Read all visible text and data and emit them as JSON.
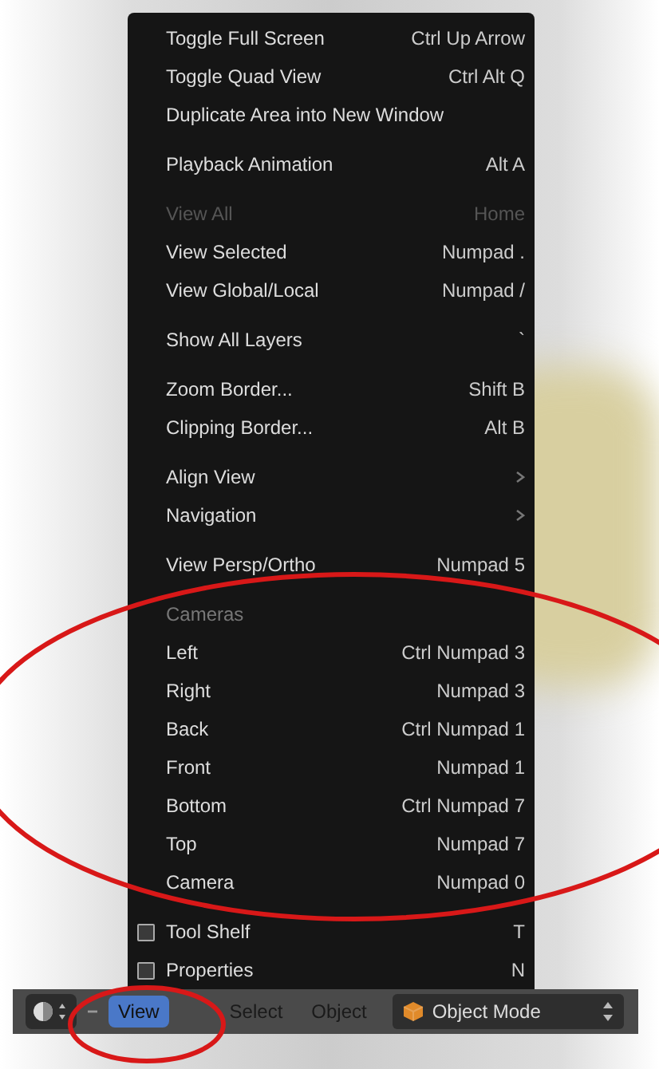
{
  "menu": {
    "sections": [
      {
        "items": [
          {
            "kind": "item",
            "label": "Toggle Full Screen",
            "shortcut": "Ctrl Up Arrow",
            "disabled": false
          },
          {
            "kind": "item",
            "label": "Toggle Quad View",
            "shortcut": "Ctrl Alt Q",
            "disabled": false
          },
          {
            "kind": "item",
            "label": "Duplicate Area into New Window",
            "disabled": false
          }
        ]
      },
      {
        "items": [
          {
            "kind": "item",
            "label": "Playback Animation",
            "shortcut": "Alt A",
            "disabled": false
          }
        ]
      },
      {
        "items": [
          {
            "kind": "item",
            "label": "View All",
            "shortcut": "Home",
            "disabled": true
          },
          {
            "kind": "item",
            "label": "View Selected",
            "shortcut": "Numpad .",
            "disabled": false
          },
          {
            "kind": "item",
            "label": "View Global/Local",
            "shortcut": "Numpad /",
            "disabled": false
          }
        ]
      },
      {
        "items": [
          {
            "kind": "item",
            "label": "Show All Layers",
            "shortcut": "`",
            "disabled": false
          }
        ]
      },
      {
        "items": [
          {
            "kind": "item",
            "label": "Zoom Border...",
            "shortcut": "Shift B",
            "disabled": false
          },
          {
            "kind": "item",
            "label": "Clipping Border...",
            "shortcut": "Alt B",
            "disabled": false
          }
        ]
      },
      {
        "items": [
          {
            "kind": "submenu",
            "label": "Align View",
            "disabled": false
          },
          {
            "kind": "submenu",
            "label": "Navigation",
            "disabled": false
          }
        ]
      },
      {
        "items": [
          {
            "kind": "item",
            "label": "View Persp/Ortho",
            "shortcut": "Numpad 5",
            "disabled": false
          }
        ]
      },
      {
        "items": [
          {
            "kind": "heading",
            "label": "Cameras"
          },
          {
            "kind": "item",
            "label": "Left",
            "shortcut": "Ctrl Numpad 3",
            "disabled": false
          },
          {
            "kind": "item",
            "label": "Right",
            "shortcut": "Numpad 3",
            "disabled": false
          },
          {
            "kind": "item",
            "label": "Back",
            "shortcut": "Ctrl Numpad 1",
            "disabled": false
          },
          {
            "kind": "item",
            "label": "Front",
            "shortcut": "Numpad 1",
            "disabled": false
          },
          {
            "kind": "item",
            "label": "Bottom",
            "shortcut": "Ctrl Numpad 7",
            "disabled": false
          },
          {
            "kind": "item",
            "label": "Top",
            "shortcut": "Numpad 7",
            "disabled": false
          },
          {
            "kind": "item",
            "label": "Camera",
            "shortcut": "Numpad 0",
            "disabled": false
          }
        ]
      },
      {
        "items": [
          {
            "kind": "checkbox",
            "label": "Tool Shelf",
            "shortcut": "T",
            "checked": false
          },
          {
            "kind": "checkbox",
            "label": "Properties",
            "shortcut": "N",
            "checked": false
          }
        ]
      }
    ]
  },
  "header": {
    "menus": [
      {
        "label": "View",
        "selected": true
      },
      {
        "label": "Select",
        "selected": false
      },
      {
        "label": "Object",
        "selected": false
      }
    ],
    "mode": "Object Mode"
  }
}
